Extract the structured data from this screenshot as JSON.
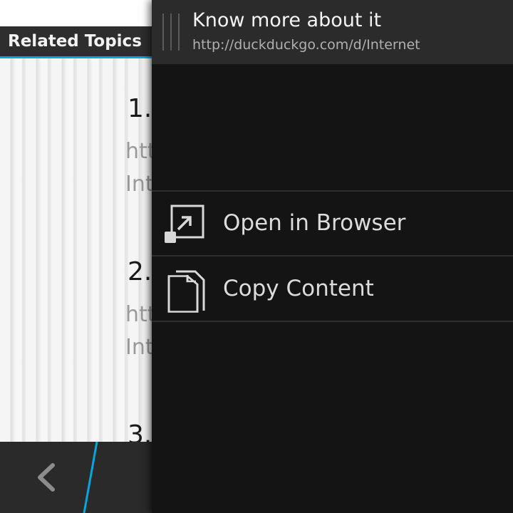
{
  "background_page": {
    "header_title": "Related Topics",
    "results": [
      {
        "number": "1.",
        "line1": "htt",
        "line2": "Int"
      },
      {
        "number": "2.",
        "line1": "htt",
        "line2": "Int"
      },
      {
        "number": "3."
      }
    ]
  },
  "menu": {
    "title": "Know more about it",
    "url": "http://duckduckgo.com/d/Internet",
    "items": [
      {
        "label": "Open in Browser",
        "icon": "open-in-browser-icon"
      },
      {
        "label": "Copy Content",
        "icon": "copy-content-icon"
      }
    ]
  },
  "colors": {
    "accent": "#00a8df",
    "menu_background": "#141414",
    "menu_header": "#2b2b2b",
    "action_bar": "#2a2a2a"
  }
}
